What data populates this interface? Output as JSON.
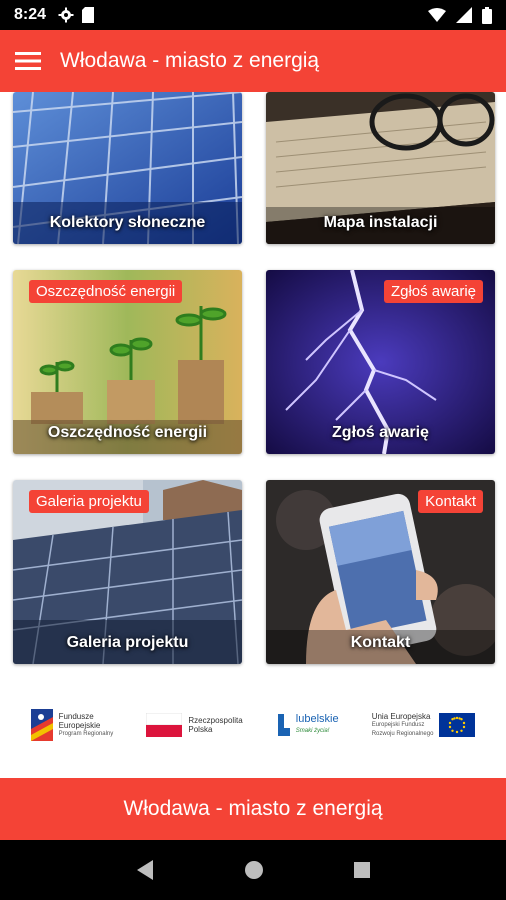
{
  "status_bar": {
    "time": "8:24",
    "icons": [
      "gear-icon",
      "sim-card-icon",
      "wifi-icon",
      "signal-icon",
      "battery-icon"
    ]
  },
  "app_bar": {
    "title": "Włodawa - miasto z energią",
    "menu_icon": "hamburger-menu-icon"
  },
  "tiles": [
    {
      "label": "Kolektory słoneczne",
      "badge": ""
    },
    {
      "label": "Mapa instalacji",
      "badge": ""
    },
    {
      "label": "Oszczędność energii",
      "badge": "Oszczędność energii"
    },
    {
      "label": "Zgłoś awarię",
      "badge": "Zgłoś awarię"
    },
    {
      "label": "Galeria projektu",
      "badge": "Galeria projektu"
    },
    {
      "label": "Kontakt",
      "badge": "Kontakt"
    }
  ],
  "logos": {
    "fe_line1": "Fundusze",
    "fe_line2": "Europejskie",
    "fe_sub": "Program Regionalny",
    "rp_line1": "Rzeczpospolita",
    "rp_line2": "Polska",
    "lubelskie_name": "lubelskie",
    "lubelskie_tagline": "Smaki życia!",
    "ue_line1": "Unia Europejska",
    "ue_sub1": "Europejski Fundusz",
    "ue_sub2": "Rozwoju Regionalnego"
  },
  "footer": {
    "title": "Włodawa - miasto z energią"
  },
  "colors": {
    "accent": "#f44336"
  },
  "nav_bar": {
    "icons": [
      "back-icon",
      "home-icon",
      "recents-icon"
    ]
  }
}
